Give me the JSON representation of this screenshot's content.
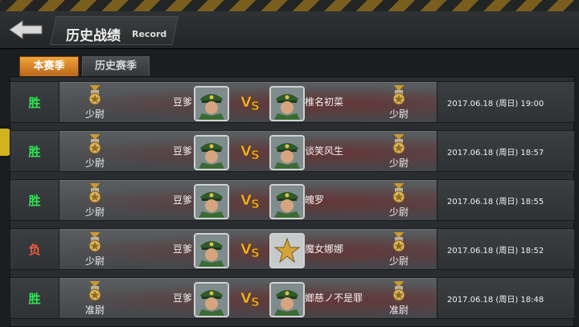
{
  "header": {
    "title": "历史战绩",
    "title_en": "Record"
  },
  "tabs": [
    {
      "label": "本赛季",
      "active": true
    },
    {
      "label": "历史赛季",
      "active": false
    }
  ],
  "rows": [
    {
      "result": "胜",
      "left_rank": "少尉",
      "left_name": "豆爹",
      "right_name": "椎名初菜",
      "right_rank": "少尉",
      "time": "2017.06.18 (周日) 19:00",
      "right_avatar": "soldier"
    },
    {
      "result": "胜",
      "left_rank": "少尉",
      "left_name": "豆爹",
      "right_name": "谈笑风生",
      "right_rank": "少尉",
      "time": "2017.06.18 (周日) 18:57",
      "right_avatar": "soldier"
    },
    {
      "result": "胜",
      "left_rank": "少尉",
      "left_name": "豆爹",
      "right_name": "魄罗",
      "right_rank": "少尉",
      "time": "2017.06.18 (周日) 18:55",
      "right_avatar": "soldier"
    },
    {
      "result": "负",
      "left_rank": "少尉",
      "left_name": "豆爹",
      "right_name": "魔女娜娜",
      "right_rank": "少尉",
      "time": "2017.06.18 (周日) 18:52",
      "right_avatar": "star"
    },
    {
      "result": "胜",
      "left_rank": "准尉",
      "left_name": "豆爹",
      "right_name": "嫏慈ノ不是罪",
      "right_rank": "准尉",
      "time": "2017.06.18 (周日) 18:48",
      "right_avatar": "soldier"
    }
  ],
  "colors": {
    "win": "#37e05a",
    "loss": "#ff5a3a",
    "tab_active": "#f0a43a"
  }
}
